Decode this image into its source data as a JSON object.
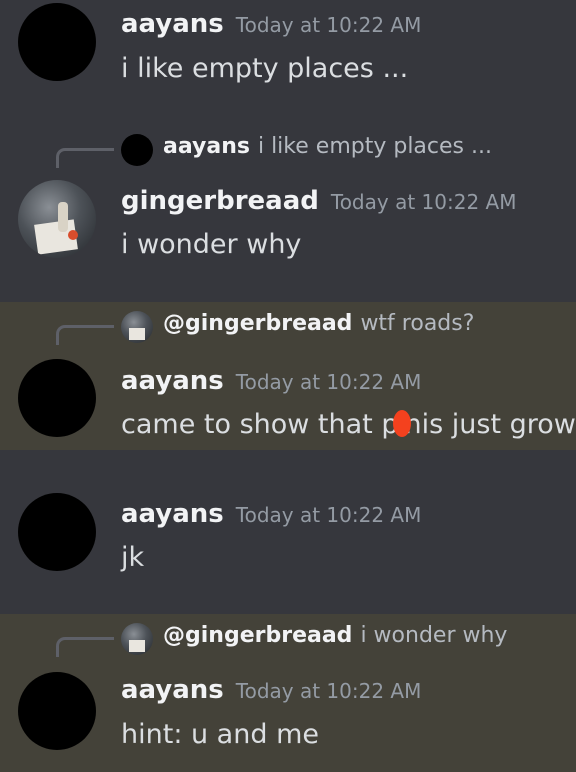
{
  "messages": [
    {
      "author": "aayans",
      "timestamp": "Today at 10:22 AM",
      "content": "i like empty places ..."
    },
    {
      "reply": {
        "author": "aayans",
        "text": "i like empty places ..."
      },
      "author": "gingerbreaad",
      "timestamp": "Today at 10:22 AM",
      "content": "i wonder why"
    },
    {
      "reply": {
        "author": "@gingerbreaad",
        "text": "wtf roads?"
      },
      "author": "aayans",
      "timestamp": "Today at 10:22 AM",
      "content_before": "came to show that p",
      "content_after": "nis just grow"
    },
    {
      "author": "aayans",
      "timestamp": "Today at 10:22 AM",
      "content": "jk"
    },
    {
      "reply": {
        "author": "@gingerbreaad",
        "text": "i wonder why"
      },
      "author": "aayans",
      "timestamp": "Today at 10:22 AM",
      "content": "hint: u and me"
    }
  ],
  "colors": {
    "background": "#36373d",
    "mention_highlight": "#444239",
    "redaction_mark": "#f4411e"
  }
}
